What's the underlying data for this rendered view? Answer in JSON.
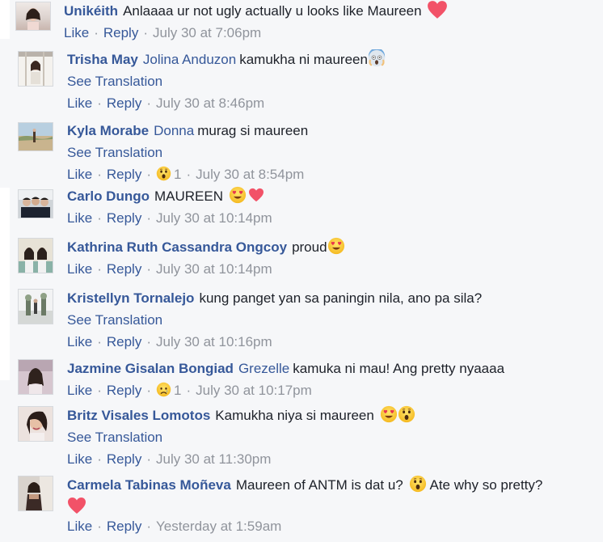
{
  "actions": {
    "like": "Like",
    "reply": "Reply",
    "see_translation": "See Translation"
  },
  "comments": [
    {
      "author": "Unikéith",
      "text": "Anlaaaa ur not ugly actually u looks like Maureen",
      "time": "July 30 at 7:06pm"
    },
    {
      "author": "Trisha May",
      "mention": "Jolina Anduzon",
      "text": "kamukha ni maureen",
      "time": "July 30 at 8:46pm"
    },
    {
      "author": "Kyla Morabe",
      "mention": "Donna",
      "text": "murag si maureen",
      "reaction_count": "1",
      "time": "July 30 at 8:54pm"
    },
    {
      "author": "Carlo Dungo",
      "text": "MAUREEN",
      "time": "July 30 at 10:14pm"
    },
    {
      "author": "Kathrina Ruth Cassandra Ongcoy",
      "text": "proud",
      "time": "July 30 at 10:14pm"
    },
    {
      "author": "Kristellyn Tornalejo",
      "text": "kung panget yan sa paningin nila, ano pa sila?",
      "time": "July 30 at 10:16pm"
    },
    {
      "author": "Jazmine Gisalan Bongiad",
      "mention": "Grezelle",
      "text": "kamuka ni mau! Ang pretty nyaaaa",
      "reaction_count": "1",
      "time": "July 30 at 10:17pm"
    },
    {
      "author": "Britz Visales Lomotos",
      "text": "Kamukha niya si maureen",
      "time": "July 30 at 11:30pm"
    },
    {
      "author": "Carmela Tabinas Moñeva",
      "text": "Maureen of ANTM is dat u?",
      "text2": "Ate why so pretty?",
      "time": "Yesterday at 1:59am"
    }
  ],
  "colors": {
    "link": "#365899",
    "meta": "#90949c",
    "text": "#1d2129",
    "background": "#f6f7f9"
  }
}
